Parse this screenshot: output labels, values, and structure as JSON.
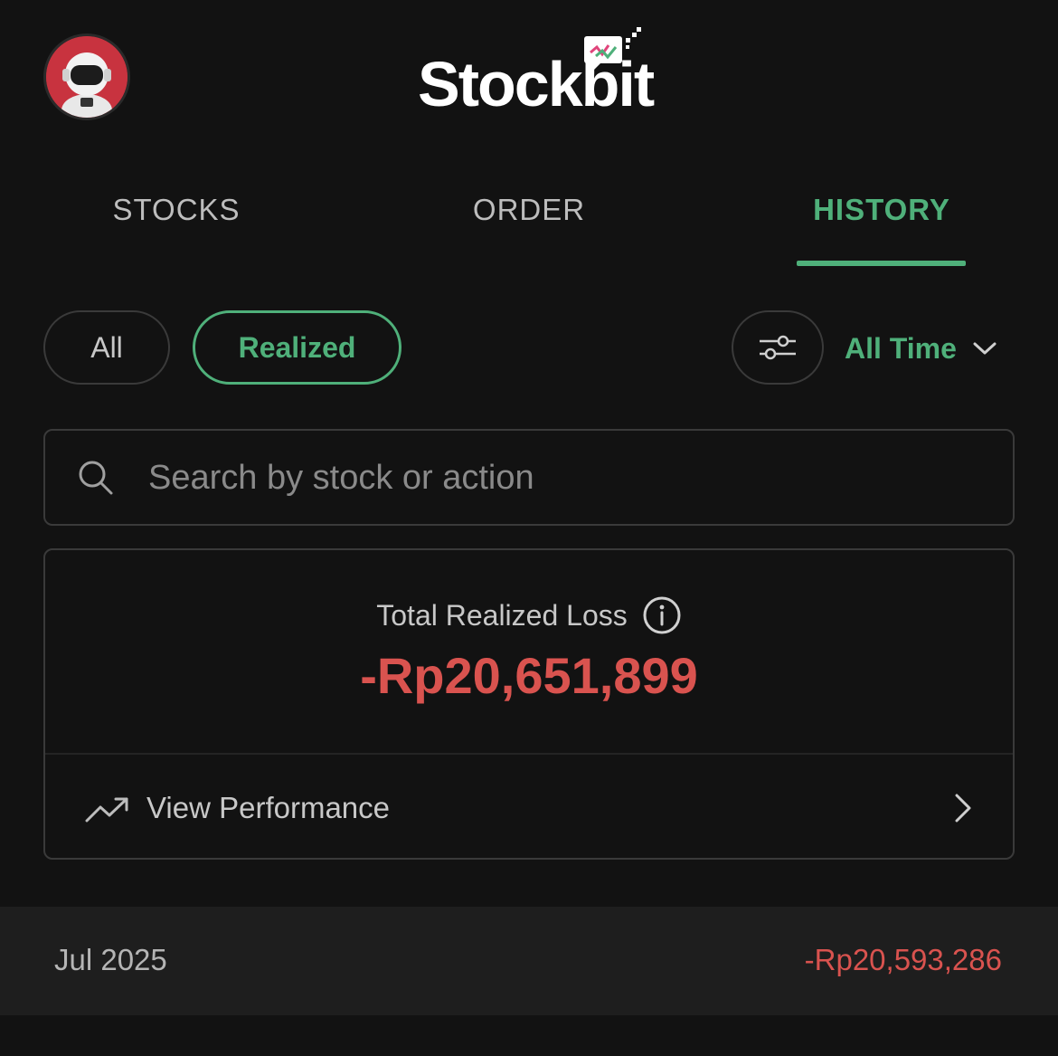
{
  "header": {
    "avatar_icon": "astronaut-avatar-icon",
    "logo_text": "Stockbit"
  },
  "tabs": [
    {
      "label": "STOCKS",
      "active": false
    },
    {
      "label": "ORDER",
      "active": false
    },
    {
      "label": "HISTORY",
      "active": true
    }
  ],
  "filters": {
    "pills": [
      {
        "label": "All",
        "active": false
      },
      {
        "label": "Realized",
        "active": true
      }
    ],
    "filter_icon": "sliders-icon",
    "time_range": "All Time"
  },
  "search": {
    "placeholder": "Search by stock or action",
    "value": ""
  },
  "summary": {
    "label": "Total Realized Loss",
    "amount": "-Rp20,651,899",
    "view_performance": "View Performance"
  },
  "months": [
    {
      "label": "Jul 2025",
      "value": "-Rp20,593,286"
    }
  ],
  "colors": {
    "background": "#121212",
    "accent_green": "#4fb07a",
    "loss_red": "#d9534f",
    "border": "#3a3a3a"
  }
}
